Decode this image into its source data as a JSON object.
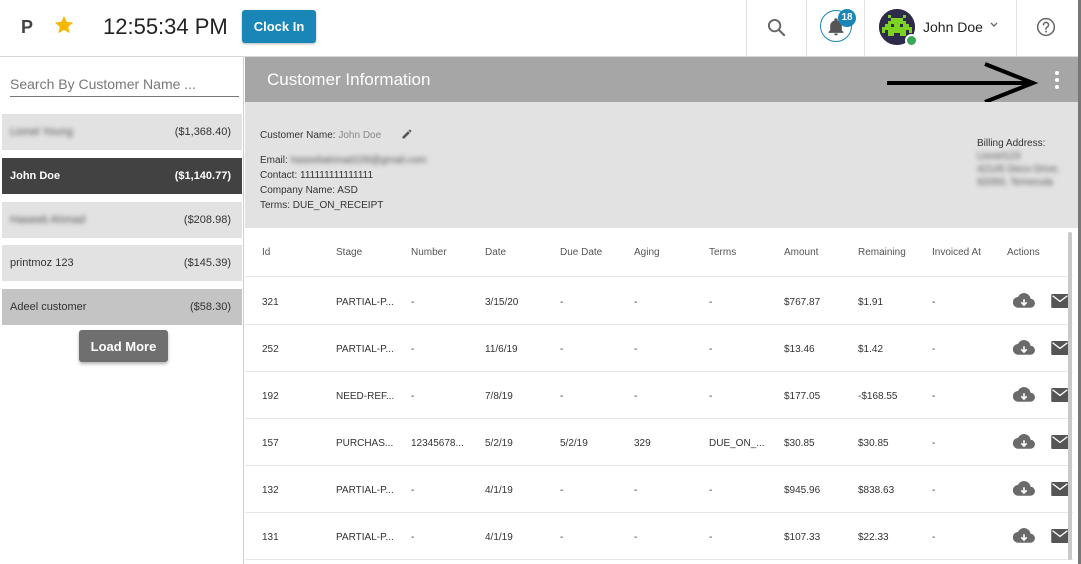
{
  "header": {
    "brand": "P",
    "time": "12:55:34 PM",
    "clock_in_label": "Clock In",
    "notification_count": "18",
    "user_name": "John Doe"
  },
  "sidebar": {
    "search_placeholder": "Search By Customer Name ...",
    "customers": [
      {
        "name": "Lionel Young",
        "amount": "($1,368.40)"
      },
      {
        "name": "John  Doe",
        "amount": "($1,140.77)"
      },
      {
        "name": "Haseeb Ahmad",
        "amount": "($208.98)"
      },
      {
        "name": "printmoz  123",
        "amount": "($145.39)"
      },
      {
        "name": "Adeel  customer",
        "amount": "($58.30)"
      }
    ],
    "load_more_label": "Load More"
  },
  "customer_info": {
    "title": "Customer Information",
    "name_label": "Customer Name:",
    "name_value": "John  Doe",
    "email_label": "Email:",
    "email_value": "haseebahmad109@gmail.com",
    "contact": "Contact: 111111111111111",
    "company": "Company Name: ASD",
    "terms": "Terms: DUE_ON_RECEIPT",
    "billing_label": "Billing Address:",
    "billing_lines": [
      "Lionel123",
      "42145 Deco Drive,",
      "92050, Temecula"
    ]
  },
  "table": {
    "columns": [
      "Id",
      "Stage",
      "Number",
      "Date",
      "Due Date",
      "Aging",
      "Terms",
      "Amount",
      "Remaining",
      "Invoiced At",
      "Actions"
    ],
    "rows": [
      [
        "321",
        "PARTIAL-P...",
        "-",
        "3/15/20",
        "-",
        "-",
        "-",
        "$767.87",
        "$1.91",
        "-"
      ],
      [
        "252",
        "PARTIAL-P...",
        "-",
        "11/6/19",
        "-",
        "-",
        "-",
        "$13.46",
        "$1.42",
        "-"
      ],
      [
        "192",
        "NEED-REF...",
        "-",
        "7/8/19",
        "-",
        "-",
        "-",
        "$177.05",
        "-$168.55",
        "-"
      ],
      [
        "157",
        "PURCHAS...",
        "12345678...",
        "5/2/19",
        "5/2/19",
        "329",
        "DUE_ON_...",
        "$30.85",
        "$30.85",
        "-"
      ],
      [
        "132",
        "PARTIAL-P...",
        "-",
        "4/1/19",
        "-",
        "-",
        "-",
        "$945.96",
        "$838.63",
        "-"
      ],
      [
        "131",
        "PARTIAL-P...",
        "-",
        "4/1/19",
        "-",
        "-",
        "-",
        "$107.33",
        "$22.33",
        "-"
      ]
    ]
  },
  "colors": {
    "accent": "#1a86b8",
    "star": "#f5b800",
    "panel_header": "#a6a6a6",
    "active_row": "#424242"
  }
}
